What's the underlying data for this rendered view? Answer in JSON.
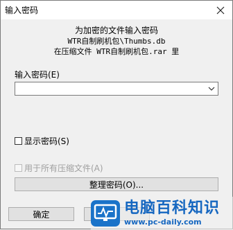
{
  "window": {
    "title": "输入密码"
  },
  "info": {
    "line1": "为加密的文件输入密码",
    "line2": "WTR自制刷机包\\Thumbs.db",
    "line3": "在压缩文件 WTR自制刷机包.rar 里"
  },
  "password": {
    "label": "输入密码(E)",
    "value": ""
  },
  "show_password": {
    "label": "显示密码(S)",
    "checked": false
  },
  "use_for_all": {
    "label": "用于所有压缩文件(A)",
    "enabled": false
  },
  "buttons": {
    "manage": "整理密码(O)...",
    "ok": "确定",
    "second": ""
  },
  "watermark": {
    "title": "电脑百科知识",
    "url": "www.pc-daily.com",
    "color": "#1667c0"
  }
}
